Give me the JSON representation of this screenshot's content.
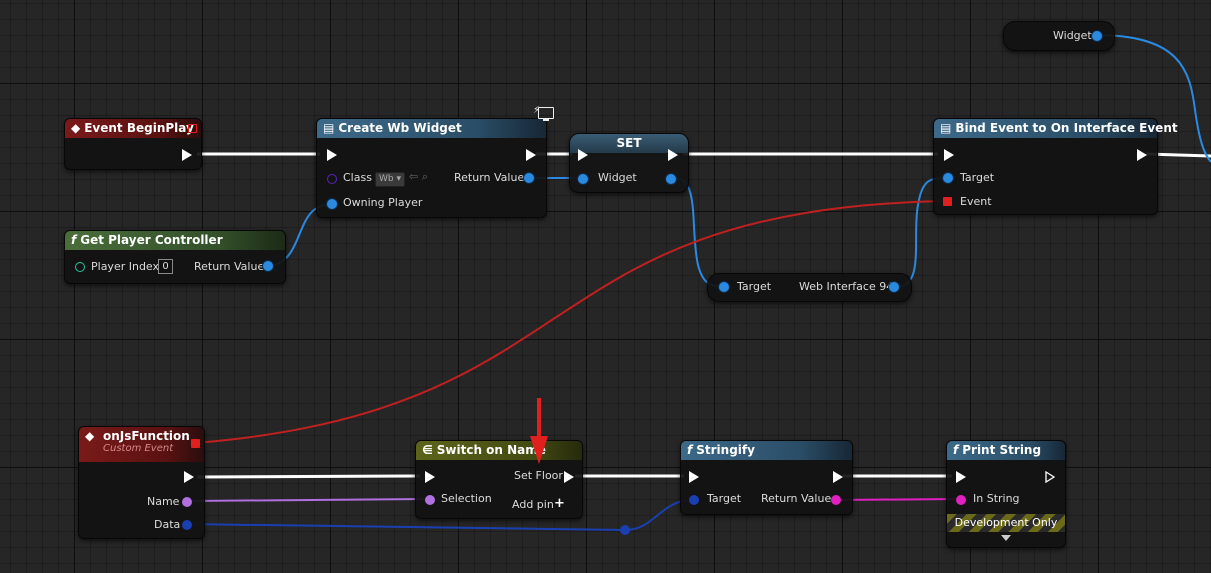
{
  "nodes": {
    "widget_getter": {
      "pin_label": "Widget"
    },
    "event_beginplay": {
      "title": "Event BeginPlay"
    },
    "create_widget": {
      "title": "Create Wb Widget",
      "class_label": "Class",
      "class_value": "Wb",
      "owning_player_label": "Owning Player",
      "return_label": "Return Value"
    },
    "set_node": {
      "title": "SET",
      "widget_label": "Widget"
    },
    "bind_event": {
      "title": "Bind Event to On Interface Event",
      "target_label": "Target",
      "event_label": "Event"
    },
    "get_player_controller": {
      "title": "Get Player Controller",
      "player_index_label": "Player Index",
      "player_index_value": "0",
      "return_label": "Return Value"
    },
    "web_interface_getter": {
      "target_label": "Target",
      "output_label": "Web Interface 94"
    },
    "on_js_function": {
      "title": "onJsFunction",
      "subtitle": "Custom Event",
      "name_label": "Name",
      "data_label": "Data"
    },
    "switch_on_name": {
      "title": "Switch on Name",
      "case_label": "Set Floor",
      "selection_label": "Selection",
      "add_pin_label": "Add pin"
    },
    "stringify": {
      "title": "Stringify",
      "target_label": "Target",
      "return_label": "Return Value"
    },
    "print_string": {
      "title": "Print String",
      "in_string_label": "In String",
      "dev_only_label": "Development Only"
    }
  },
  "colors": {
    "exec": "#ffffff",
    "object_ref": "#2a8ae0",
    "name": "#b070e0",
    "structure": "#1a3fb0",
    "string": "#e020c0",
    "delegate": "#c02020",
    "annotation_arrow": "#e0201f"
  },
  "icons": [
    "event-diamond-icon",
    "function-icon",
    "widget-icon",
    "monitor-icon",
    "switch-icon",
    "add-pin-icon",
    "annotation-arrow"
  ]
}
